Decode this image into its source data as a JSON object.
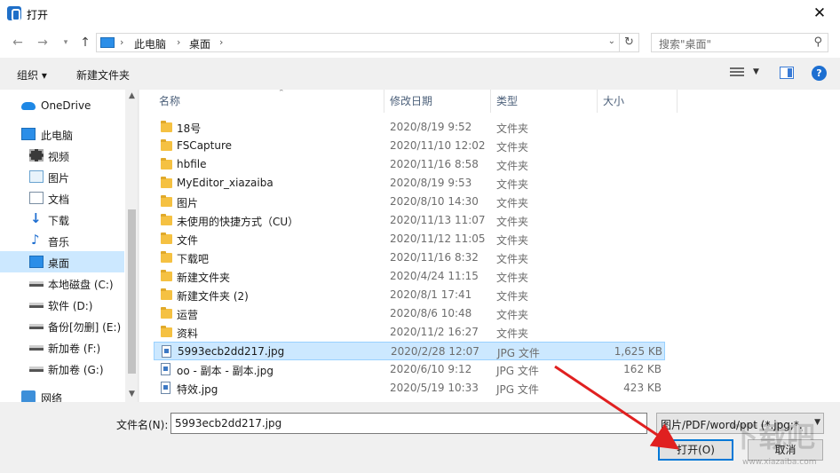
{
  "title": "打开",
  "address": {
    "crumbs": [
      "此电脑",
      "桌面"
    ]
  },
  "search": {
    "placeholder": "搜索\"桌面\""
  },
  "toolbar": {
    "organize": "组织 ▾",
    "new_folder": "新建文件夹"
  },
  "nav": {
    "items": [
      {
        "label": "OneDrive",
        "icon": "cloud-icon"
      },
      {
        "label": "此电脑",
        "icon": "computer-icon"
      },
      {
        "label": "视频",
        "icon": "video-icon"
      },
      {
        "label": "图片",
        "icon": "picture-icon"
      },
      {
        "label": "文档",
        "icon": "document-icon"
      },
      {
        "label": "下载",
        "icon": "download-icon"
      },
      {
        "label": "音乐",
        "icon": "music-icon"
      },
      {
        "label": "桌面",
        "icon": "desktop-icon"
      },
      {
        "label": "本地磁盘 (C:)",
        "icon": "drive-icon"
      },
      {
        "label": "软件 (D:)",
        "icon": "drive-icon"
      },
      {
        "label": "备份[勿删] (E:)",
        "icon": "drive-icon"
      },
      {
        "label": "新加卷 (F:)",
        "icon": "drive-icon"
      },
      {
        "label": "新加卷 (G:)",
        "icon": "drive-icon"
      },
      {
        "label": "网络",
        "icon": "network-icon"
      }
    ]
  },
  "columns": {
    "name": "名称",
    "date": "修改日期",
    "type": "类型",
    "size": "大小"
  },
  "files": [
    {
      "name": "18号",
      "date": "2020/8/19 9:52",
      "type": "文件夹",
      "size": ""
    },
    {
      "name": "FSCapture",
      "date": "2020/11/10 12:02",
      "type": "文件夹",
      "size": ""
    },
    {
      "name": "hbfile",
      "date": "2020/11/16 8:58",
      "type": "文件夹",
      "size": ""
    },
    {
      "name": "MyEditor_xiazaiba",
      "date": "2020/8/19 9:53",
      "type": "文件夹",
      "size": ""
    },
    {
      "name": "图片",
      "date": "2020/8/10 14:30",
      "type": "文件夹",
      "size": ""
    },
    {
      "name": "未使用的快捷方式（CU）",
      "date": "2020/11/13 11:07",
      "type": "文件夹",
      "size": ""
    },
    {
      "name": "文件",
      "date": "2020/11/12 11:05",
      "type": "文件夹",
      "size": ""
    },
    {
      "name": "下载吧",
      "date": "2020/11/16 8:32",
      "type": "文件夹",
      "size": ""
    },
    {
      "name": "新建文件夹",
      "date": "2020/4/24 11:15",
      "type": "文件夹",
      "size": ""
    },
    {
      "name": "新建文件夹 (2)",
      "date": "2020/8/1 17:41",
      "type": "文件夹",
      "size": ""
    },
    {
      "name": "运营",
      "date": "2020/8/6 10:48",
      "type": "文件夹",
      "size": ""
    },
    {
      "name": "资料",
      "date": "2020/11/2 16:27",
      "type": "文件夹",
      "size": ""
    },
    {
      "name": "5993ecb2dd217.jpg",
      "date": "2020/2/28 12:07",
      "type": "JPG 文件",
      "size": "1,625 KB"
    },
    {
      "name": "oo - 副本 - 副本.jpg",
      "date": "2020/6/10 9:12",
      "type": "JPG 文件",
      "size": "162 KB"
    },
    {
      "name": "特效.jpg",
      "date": "2020/5/19 10:33",
      "type": "JPG 文件",
      "size": "423 KB"
    }
  ],
  "bottom": {
    "filename_label": "文件名(N):",
    "filename_value": "5993ecb2dd217.jpg",
    "filter": "图片/PDF/word/ppt (*.jpg;*.jpeg",
    "open_button": "打开(O)",
    "cancel_button": "取消"
  },
  "watermark": {
    "text": "下载吧",
    "sub": "www.xiazaiba.com"
  },
  "colors": {
    "selection": "#cce8ff",
    "accent": "#0078d7",
    "arrow": "#e02020"
  }
}
